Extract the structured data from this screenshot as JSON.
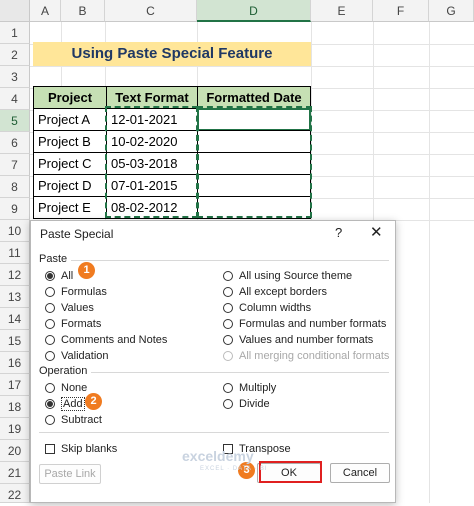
{
  "columns": [
    "A",
    "B",
    "C",
    "D",
    "E",
    "F",
    "G"
  ],
  "rows": [
    "1",
    "2",
    "3",
    "4",
    "5",
    "6",
    "7",
    "8",
    "9",
    "10",
    "11",
    "12",
    "13",
    "14",
    "15",
    "16",
    "17",
    "18",
    "19",
    "20",
    "21",
    "22"
  ],
  "title": "Using Paste Special Feature",
  "table": {
    "headers": [
      "Project",
      "Text Format",
      "Formatted Date"
    ],
    "rows": [
      [
        "Project A",
        "12-01-2021",
        ""
      ],
      [
        "Project B",
        "10-02-2020",
        ""
      ],
      [
        "Project C",
        "05-03-2018",
        ""
      ],
      [
        "Project D",
        "07-01-2015",
        ""
      ],
      [
        "Project E",
        "08-02-2012",
        ""
      ]
    ]
  },
  "dialog": {
    "title": "Paste Special",
    "help": "?",
    "close": "✕",
    "paste_label": "Paste",
    "paste_left": [
      "All",
      "Formulas",
      "Values",
      "Formats",
      "Comments and Notes",
      "Validation"
    ],
    "paste_right": [
      "All using Source theme",
      "All except borders",
      "Column widths",
      "Formulas and number formats",
      "Values and number formats",
      "All merging conditional formats"
    ],
    "selected_paste": "All",
    "operation_label": "Operation",
    "op_left": [
      "None",
      "Add",
      "Subtract"
    ],
    "op_right": [
      "Multiply",
      "Divide"
    ],
    "selected_operation": "Add",
    "skip_blanks": "Skip blanks",
    "transpose": "Transpose",
    "paste_link": "Paste Link",
    "ok": "OK",
    "cancel": "Cancel"
  },
  "badges": [
    "1",
    "2",
    "3"
  ],
  "watermark": {
    "name": "exceldemy",
    "tagline": "EXCEL · DATA · BI"
  },
  "colors": {
    "accent": "#217346",
    "title_fill": "#ffe699",
    "header_fill": "#c6e0b4",
    "badge": "#f07b20",
    "highlight": "#e02020"
  }
}
